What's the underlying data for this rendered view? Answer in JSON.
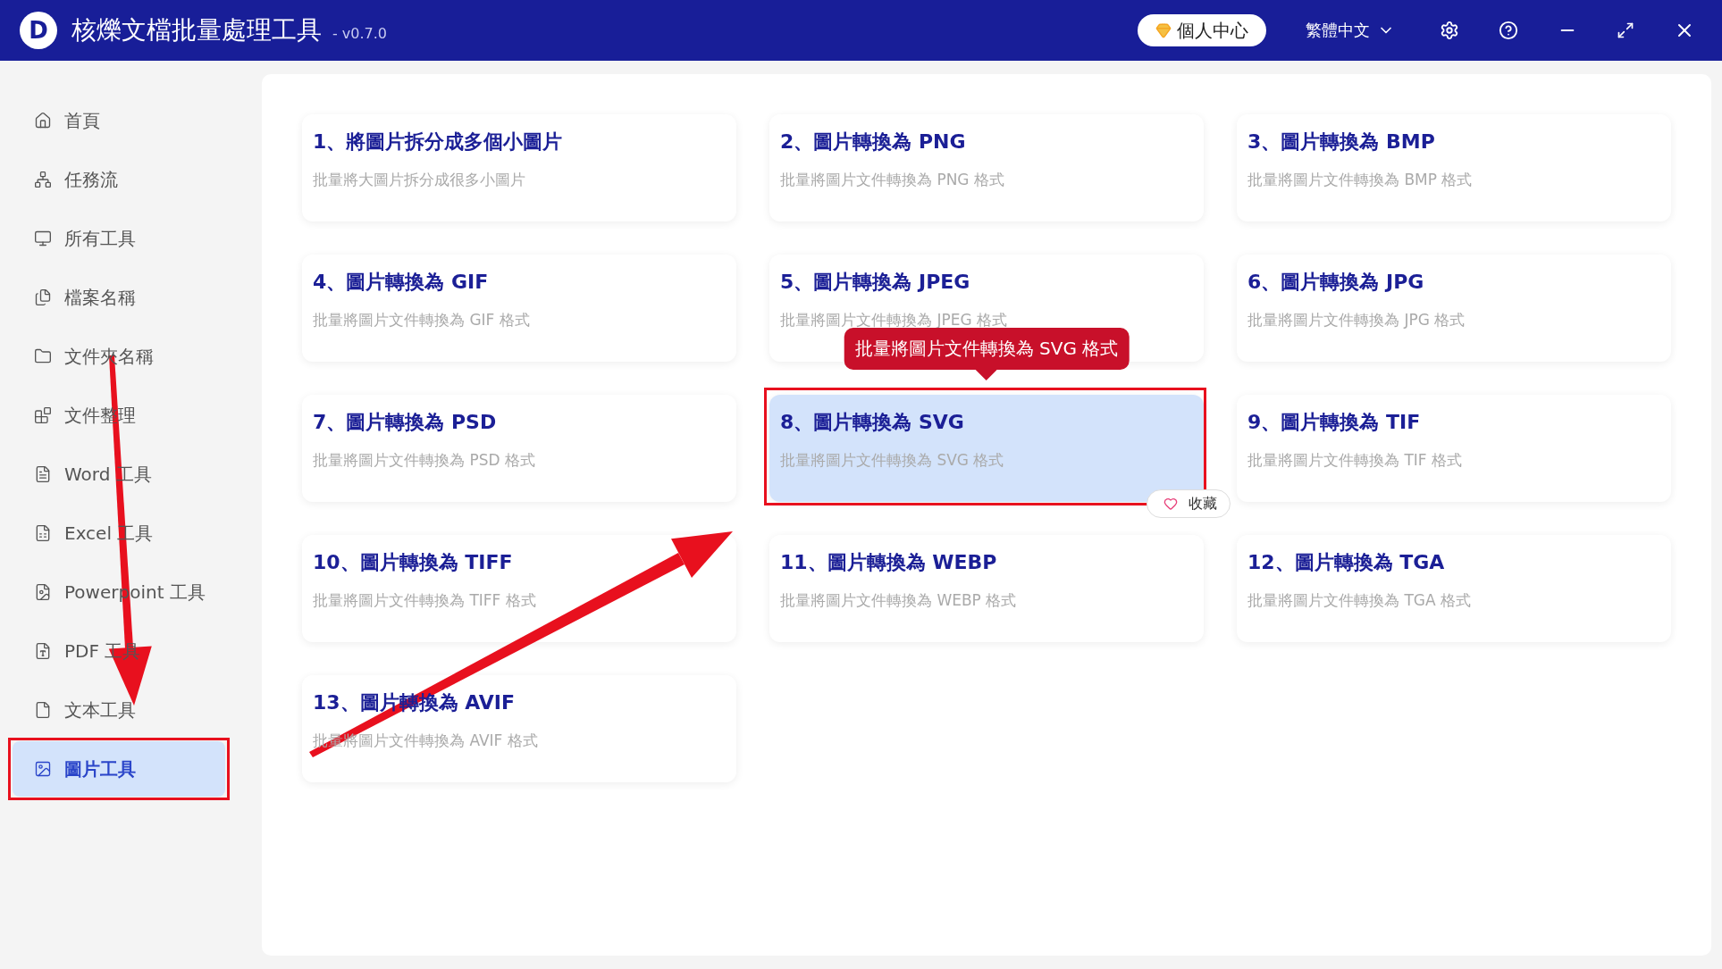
{
  "header": {
    "logo_letter": "D",
    "title": "核爍文檔批量處理工具",
    "version": "- v0.7.0",
    "account_button": "個人中心",
    "language": "繁體中文"
  },
  "sidebar": {
    "items": [
      {
        "label": "首頁",
        "selected": false
      },
      {
        "label": "任務流",
        "selected": false
      },
      {
        "label": "所有工具",
        "selected": false
      },
      {
        "label": "檔案名稱",
        "selected": false
      },
      {
        "label": "文件夾名稱",
        "selected": false
      },
      {
        "label": "文件整理",
        "selected": false
      },
      {
        "label": "Word 工具",
        "selected": false
      },
      {
        "label": "Excel 工具",
        "selected": false
      },
      {
        "label": "Powerpoint 工具",
        "selected": false
      },
      {
        "label": "PDF 工具",
        "selected": false
      },
      {
        "label": "文本工具",
        "selected": false
      },
      {
        "label": "圖片工具",
        "selected": true
      }
    ]
  },
  "tools": [
    {
      "title": "1、將圖片拆分成多個小圖片",
      "description": "批量將大圖片拆分成很多小圖片",
      "selected": false
    },
    {
      "title": "2、圖片轉換為 PNG",
      "description": "批量將圖片文件轉換為 PNG 格式",
      "selected": false
    },
    {
      "title": "3、圖片轉換為 BMP",
      "description": "批量將圖片文件轉換為 BMP 格式",
      "selected": false
    },
    {
      "title": "4、圖片轉換為 GIF",
      "description": "批量將圖片文件轉換為 GIF 格式",
      "selected": false
    },
    {
      "title": "5、圖片轉換為 JPEG",
      "description": "批量將圖片文件轉換為 JPEG 格式",
      "selected": false
    },
    {
      "title": "6、圖片轉換為 JPG",
      "description": "批量將圖片文件轉換為 JPG 格式",
      "selected": false
    },
    {
      "title": "7、圖片轉換為 PSD",
      "description": "批量將圖片文件轉換為 PSD 格式",
      "selected": false
    },
    {
      "title": "8、圖片轉換為 SVG",
      "description": "批量將圖片文件轉換為 SVG 格式",
      "selected": true,
      "favorite": "收藏"
    },
    {
      "title": "9、圖片轉換為 TIF",
      "description": "批量將圖片文件轉換為 TIF 格式",
      "selected": false
    },
    {
      "title": "10、圖片轉換為 TIFF",
      "description": "批量將圖片文件轉換為 TIFF 格式",
      "selected": false
    },
    {
      "title": "11、圖片轉換為 WEBP",
      "description": "批量將圖片文件轉換為 WEBP 格式",
      "selected": false
    },
    {
      "title": "12、圖片轉換為 TGA",
      "description": "批量將圖片文件轉換為 TGA 格式",
      "selected": false
    },
    {
      "title": "13、圖片轉換為 AVIF",
      "description": "批量將圖片文件轉換為 AVIF 格式",
      "selected": false
    }
  ],
  "tooltip": {
    "text": "批量將圖片文件轉換為 SVG 格式"
  }
}
